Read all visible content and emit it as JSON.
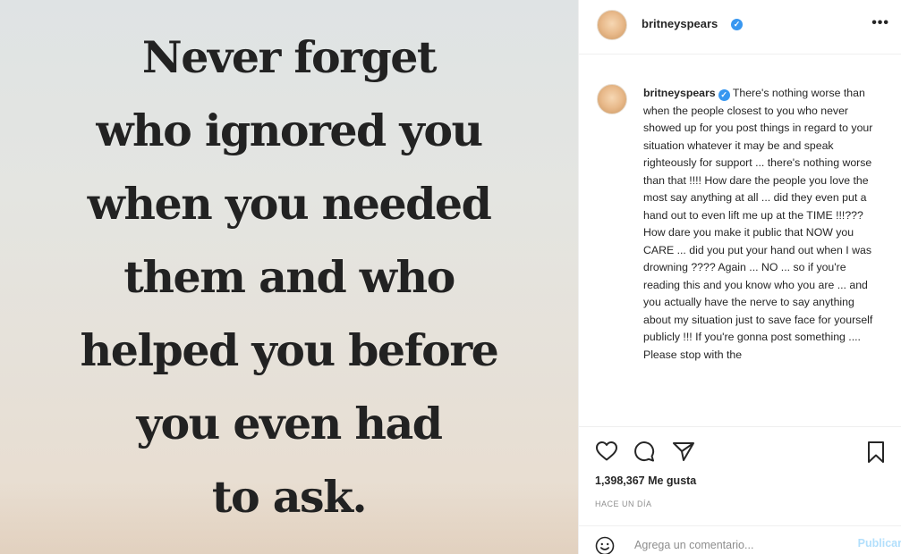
{
  "post_image": {
    "quote_lines": [
      "Never forget",
      "who ignored you",
      "when you needed",
      "them and who",
      "helped you before",
      "you even had",
      "to ask."
    ]
  },
  "header": {
    "username": "britneyspears",
    "verified_icon": "verified-badge-icon",
    "more_icon": "•••"
  },
  "caption": {
    "username": "britneyspears",
    "text": "There's nothing worse than when the people closest to you who never showed up for you post things in regard to your situation whatever it may be and speak righteously for support ... there's nothing worse than that !!!! How dare the people you love the most say anything at all ... did they even put a hand out to even lift me up at the TIME !!!??? How dare you make it public that NOW you CARE ... did you put your hand out when I was drowning ???? Again ... NO ... so if you're reading this and you know who you are ... and you actually have the nerve to say anything about my situation just to save face for yourself publicly !!! If you're gonna post something .... Please stop with the"
  },
  "actions": {
    "likes": "1,398,367 Me gusta",
    "timestamp": "HACE UN DÍA"
  },
  "comment_box": {
    "placeholder": "Agrega un comentario...",
    "post_label": "Publicar"
  },
  "colors": {
    "accent": "#3897f0",
    "post_button_disabled": "#b2dffc",
    "muted_text": "#8e8e8e"
  }
}
